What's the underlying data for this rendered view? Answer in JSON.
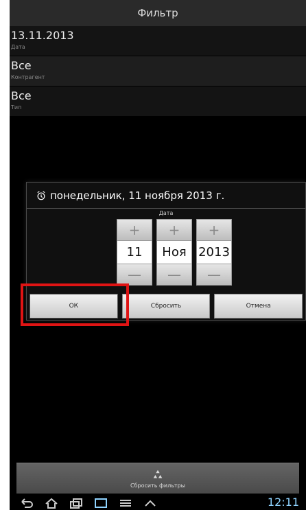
{
  "header": {
    "title": "Фильтр"
  },
  "filters": [
    {
      "value": "13.11.2013",
      "label": "Дата"
    },
    {
      "value": "Все",
      "label": "Контрагент"
    },
    {
      "value": "Все",
      "label": "Тип"
    }
  ],
  "dialog": {
    "title": "понедельник, 11 ноября 2013 г.",
    "picker_label": "Дата",
    "day": "11",
    "month": "Ноя",
    "year": "2013",
    "plus": "+",
    "minus": "—",
    "buttons": {
      "ok": "ОК",
      "reset": "Сбросить",
      "cancel": "Отмена"
    }
  },
  "bottom": {
    "reset_filters": "Сбросить фильтры"
  },
  "status": {
    "time": "12:11"
  },
  "icons": [
    "alarm-icon",
    "recycle-icon",
    "back-icon",
    "home-icon",
    "recent-apps-icon",
    "screenshot-icon",
    "menu-icon",
    "up-icon"
  ],
  "colors": {
    "highlight": "#e01414",
    "background": "#000000"
  }
}
